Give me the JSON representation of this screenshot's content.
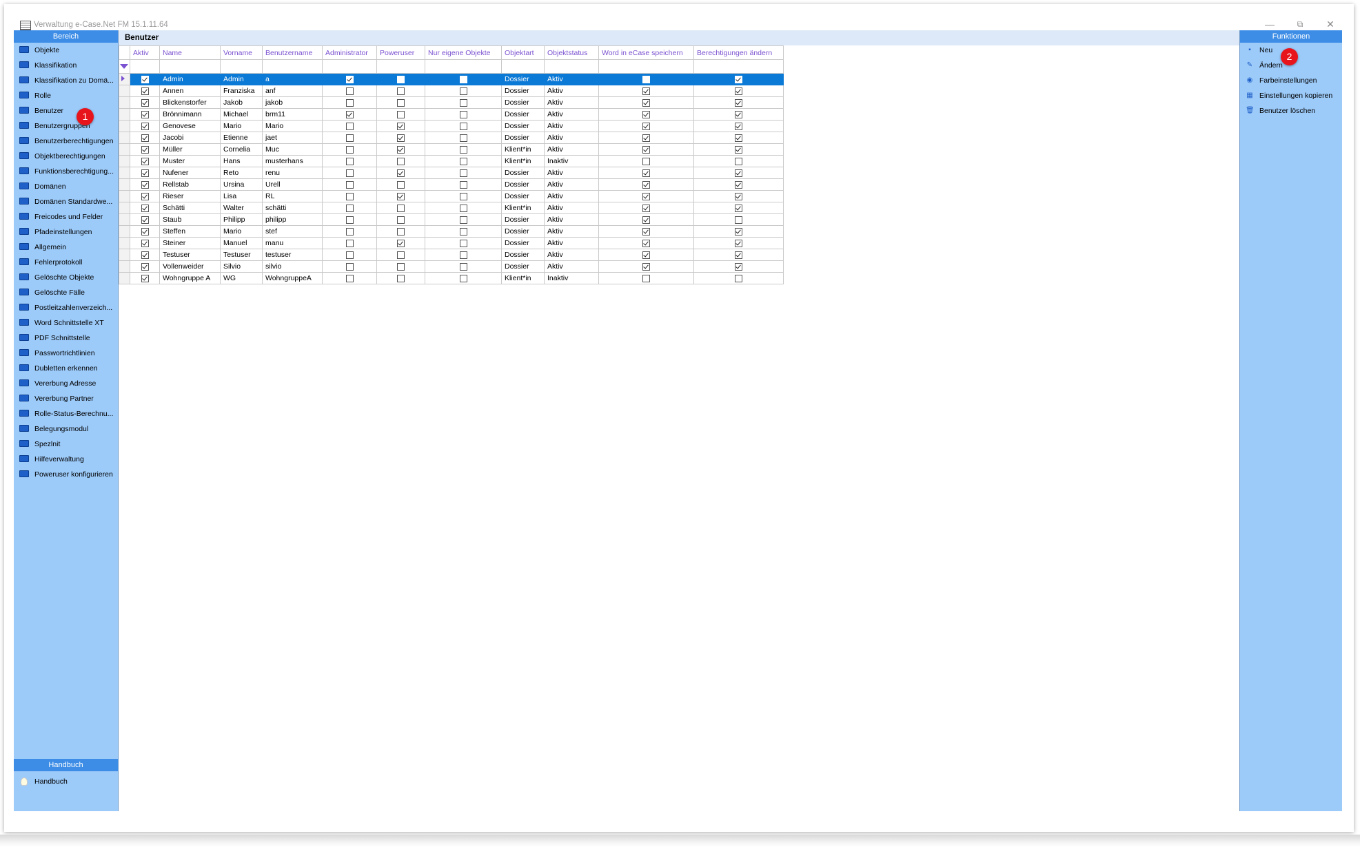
{
  "window": {
    "title": "Verwaltung e-Case.Net FM 15.1.11.64"
  },
  "left_panel": {
    "header": "Bereich",
    "items": [
      "Objekte",
      "Klassifikation",
      "Klassifikation zu Domä...",
      "Rolle",
      "Benutzer",
      "Benutzergruppen",
      "Benutzerberechtigungen",
      "Objektberechtigungen",
      "Funktionsberechtigung...",
      "Domänen",
      "Domänen Standardwe...",
      "Freicodes und Felder",
      "Pfadeinstellungen",
      "Allgemein",
      "Fehlerprotokoll",
      "Gelöschte Objekte",
      "Gelöschte Fälle",
      "Postleitzahlenverzeich...",
      "Word Schnittstelle XT",
      "PDF Schnittstelle",
      "Passwortrichtlinien",
      "Dubletten erkennen",
      "Vererbung Adresse",
      "Vererbung Partner",
      "Rolle-Status-Berechnu...",
      "Belegungsmodul",
      "Spezlnit",
      "Hilfeverwaltung",
      "Poweruser konfigurieren"
    ],
    "handbuch_header": "Handbuch",
    "handbuch_item": "Handbuch"
  },
  "right_panel": {
    "header": "Funktionen",
    "items": [
      {
        "label": "Neu",
        "icon": "new-icon"
      },
      {
        "label": "Ändern",
        "icon": "edit-icon"
      },
      {
        "label": "Farbeinstellungen",
        "icon": "color-settings-icon"
      },
      {
        "label": "Einstellungen kopieren",
        "icon": "copy-settings-icon"
      },
      {
        "label": "Benutzer löschen",
        "icon": "delete-icon"
      }
    ]
  },
  "main": {
    "title": "Benutzer",
    "columns": [
      "Aktiv",
      "Name",
      "Vorname",
      "Benutzername",
      "Administrator",
      "Poweruser",
      "Nur eigene Objekte",
      "Objektart",
      "Objektstatus",
      "Word in eCase speichern",
      "Berechtigungen ändern"
    ],
    "rows": [
      {
        "aktiv": true,
        "name": "Admin",
        "vorname": "Admin",
        "benutzername": "a",
        "admin": true,
        "poweruser": false,
        "nur_eigene": false,
        "objektart": "Dossier",
        "objektstatus": "Aktiv",
        "word": false,
        "berechtigungen": true,
        "selected": true
      },
      {
        "aktiv": true,
        "name": "Annen",
        "vorname": "Franziska",
        "benutzername": "anf",
        "admin": false,
        "poweruser": false,
        "nur_eigene": false,
        "objektart": "Dossier",
        "objektstatus": "Aktiv",
        "word": true,
        "berechtigungen": true
      },
      {
        "aktiv": true,
        "name": "Blickenstorfer",
        "vorname": "Jakob",
        "benutzername": "jakob",
        "admin": false,
        "poweruser": false,
        "nur_eigene": false,
        "objektart": "Dossier",
        "objektstatus": "Aktiv",
        "word": true,
        "berechtigungen": true
      },
      {
        "aktiv": true,
        "name": "Brönnimann",
        "vorname": "Michael",
        "benutzername": "brm11",
        "admin": true,
        "poweruser": false,
        "nur_eigene": false,
        "objektart": "Dossier",
        "objektstatus": "Aktiv",
        "word": true,
        "berechtigungen": true
      },
      {
        "aktiv": true,
        "name": "Genovese",
        "vorname": "Mario",
        "benutzername": "Mario",
        "admin": false,
        "poweruser": true,
        "nur_eigene": false,
        "objektart": "Dossier",
        "objektstatus": "Aktiv",
        "word": true,
        "berechtigungen": true
      },
      {
        "aktiv": true,
        "name": "Jacobi",
        "vorname": "Etienne",
        "benutzername": "jaet",
        "admin": false,
        "poweruser": true,
        "nur_eigene": false,
        "objektart": "Dossier",
        "objektstatus": "Aktiv",
        "word": true,
        "berechtigungen": true
      },
      {
        "aktiv": true,
        "name": "Müller",
        "vorname": "Cornelia",
        "benutzername": "Muc",
        "admin": false,
        "poweruser": true,
        "nur_eigene": false,
        "objektart": "Klient*in",
        "objektstatus": "Aktiv",
        "word": true,
        "berechtigungen": true
      },
      {
        "aktiv": true,
        "name": "Muster",
        "vorname": "Hans",
        "benutzername": "musterhans",
        "admin": false,
        "poweruser": false,
        "nur_eigene": false,
        "objektart": "Klient*in",
        "objektstatus": "Inaktiv",
        "word": false,
        "berechtigungen": false
      },
      {
        "aktiv": true,
        "name": "Nufener",
        "vorname": "Reto",
        "benutzername": "renu",
        "admin": false,
        "poweruser": true,
        "nur_eigene": false,
        "objektart": "Dossier",
        "objektstatus": "Aktiv",
        "word": true,
        "berechtigungen": true
      },
      {
        "aktiv": true,
        "name": "Rellstab",
        "vorname": "Ursina",
        "benutzername": "Urell",
        "admin": false,
        "poweruser": false,
        "nur_eigene": false,
        "objektart": "Dossier",
        "objektstatus": "Aktiv",
        "word": true,
        "berechtigungen": true
      },
      {
        "aktiv": true,
        "name": "Rieser",
        "vorname": "Lisa",
        "benutzername": "RL",
        "admin": false,
        "poweruser": true,
        "nur_eigene": false,
        "objektart": "Dossier",
        "objektstatus": "Aktiv",
        "word": true,
        "berechtigungen": true
      },
      {
        "aktiv": true,
        "name": "Schätti",
        "vorname": "Walter",
        "benutzername": "schätti",
        "admin": false,
        "poweruser": false,
        "nur_eigene": false,
        "objektart": "Klient*in",
        "objektstatus": "Aktiv",
        "word": true,
        "berechtigungen": true
      },
      {
        "aktiv": true,
        "name": "Staub",
        "vorname": "Philipp",
        "benutzername": "philipp",
        "admin": false,
        "poweruser": false,
        "nur_eigene": false,
        "objektart": "Dossier",
        "objektstatus": "Aktiv",
        "word": true,
        "berechtigungen": false
      },
      {
        "aktiv": true,
        "name": "Steffen",
        "vorname": "Mario",
        "benutzername": "stef",
        "admin": false,
        "poweruser": false,
        "nur_eigene": false,
        "objektart": "Dossier",
        "objektstatus": "Aktiv",
        "word": true,
        "berechtigungen": true
      },
      {
        "aktiv": true,
        "name": "Steiner",
        "vorname": "Manuel",
        "benutzername": "manu",
        "admin": false,
        "poweruser": true,
        "nur_eigene": false,
        "objektart": "Dossier",
        "objektstatus": "Aktiv",
        "word": true,
        "berechtigungen": true
      },
      {
        "aktiv": true,
        "name": "Testuser",
        "vorname": "Testuser",
        "benutzername": "testuser",
        "admin": false,
        "poweruser": false,
        "nur_eigene": false,
        "objektart": "Dossier",
        "objektstatus": "Aktiv",
        "word": true,
        "berechtigungen": true
      },
      {
        "aktiv": true,
        "name": "Vollenweider",
        "vorname": "Silvio",
        "benutzername": "silvio",
        "admin": false,
        "poweruser": false,
        "nur_eigene": false,
        "objektart": "Dossier",
        "objektstatus": "Aktiv",
        "word": true,
        "berechtigungen": true
      },
      {
        "aktiv": true,
        "name": "Wohngruppe A",
        "vorname": "WG",
        "benutzername": "WohngruppeA",
        "admin": false,
        "poweruser": false,
        "nur_eigene": false,
        "objektart": "Klient*in",
        "objektstatus": "Inaktiv",
        "word": false,
        "berechtigungen": false
      }
    ]
  },
  "annotations": {
    "badge1": "1",
    "badge2": "2"
  },
  "colors": {
    "panel": "#9ccaf9",
    "panel_header": "#3d8de6",
    "selection": "#0b79d6",
    "header_text": "#7b52d1",
    "badge": "#e8141c"
  }
}
